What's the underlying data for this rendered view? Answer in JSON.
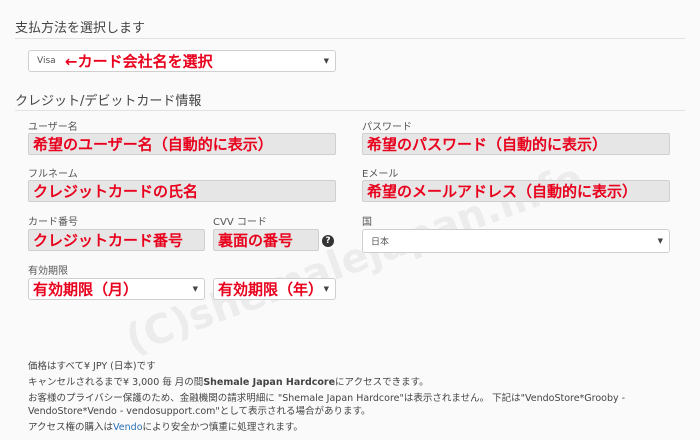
{
  "payment": {
    "title": "支払方法を選択します",
    "card_select": {
      "value": "Visa",
      "annotation": "←カード会社名を選択"
    }
  },
  "card_info": {
    "title": "クレジット/デビットカード情報",
    "username": {
      "label": "ユーザー名",
      "annotation": "希望のユーザー名（自動的に表示）"
    },
    "password": {
      "label": "パスワード",
      "annotation": "希望のパスワード（自動的に表示）"
    },
    "fullname": {
      "label": "フルネーム",
      "annotation": "クレジットカードの氏名"
    },
    "email": {
      "label": "Eメール",
      "annotation": "希望のメールアドレス（自動的に表示）"
    },
    "card_number": {
      "label": "カード番号",
      "annotation": "クレジットカード番号"
    },
    "cvv": {
      "label": "CVV コード",
      "annotation": "裏面の番号",
      "help_icon": "?"
    },
    "country": {
      "label": "国",
      "value": "日本"
    },
    "expiry": {
      "label": "有効期限",
      "month_annotation": "有効期限（月）",
      "year_annotation": "有効期限（年）"
    }
  },
  "info": {
    "line1": "価格はすべて¥ JPY (日本)です",
    "line2_pre": "キャンセルされるまで¥ 3,000 毎 月の間",
    "line2_bold": "Shemale Japan Hardcore",
    "line2_post": "にアクセスできます。",
    "line3": "お客様のプライバシー保護のため、金融機関の請求明細に \"Shemale Japan Hardcore\"は表示されません。 下記は\"VendoStore*Grooby -",
    "line4": "VendoStore*Vendo - vendosupport.com\"として表示される場合があります。",
    "line5_pre": "アクセス権の購入は",
    "line5_link": "Vendo",
    "line5_post": "により安全かつ慎重に処理されます。"
  },
  "watermark": "(C)shemalejapan.info",
  "colors": {
    "annotation": "#e8001c",
    "link": "#2a6fb4"
  }
}
